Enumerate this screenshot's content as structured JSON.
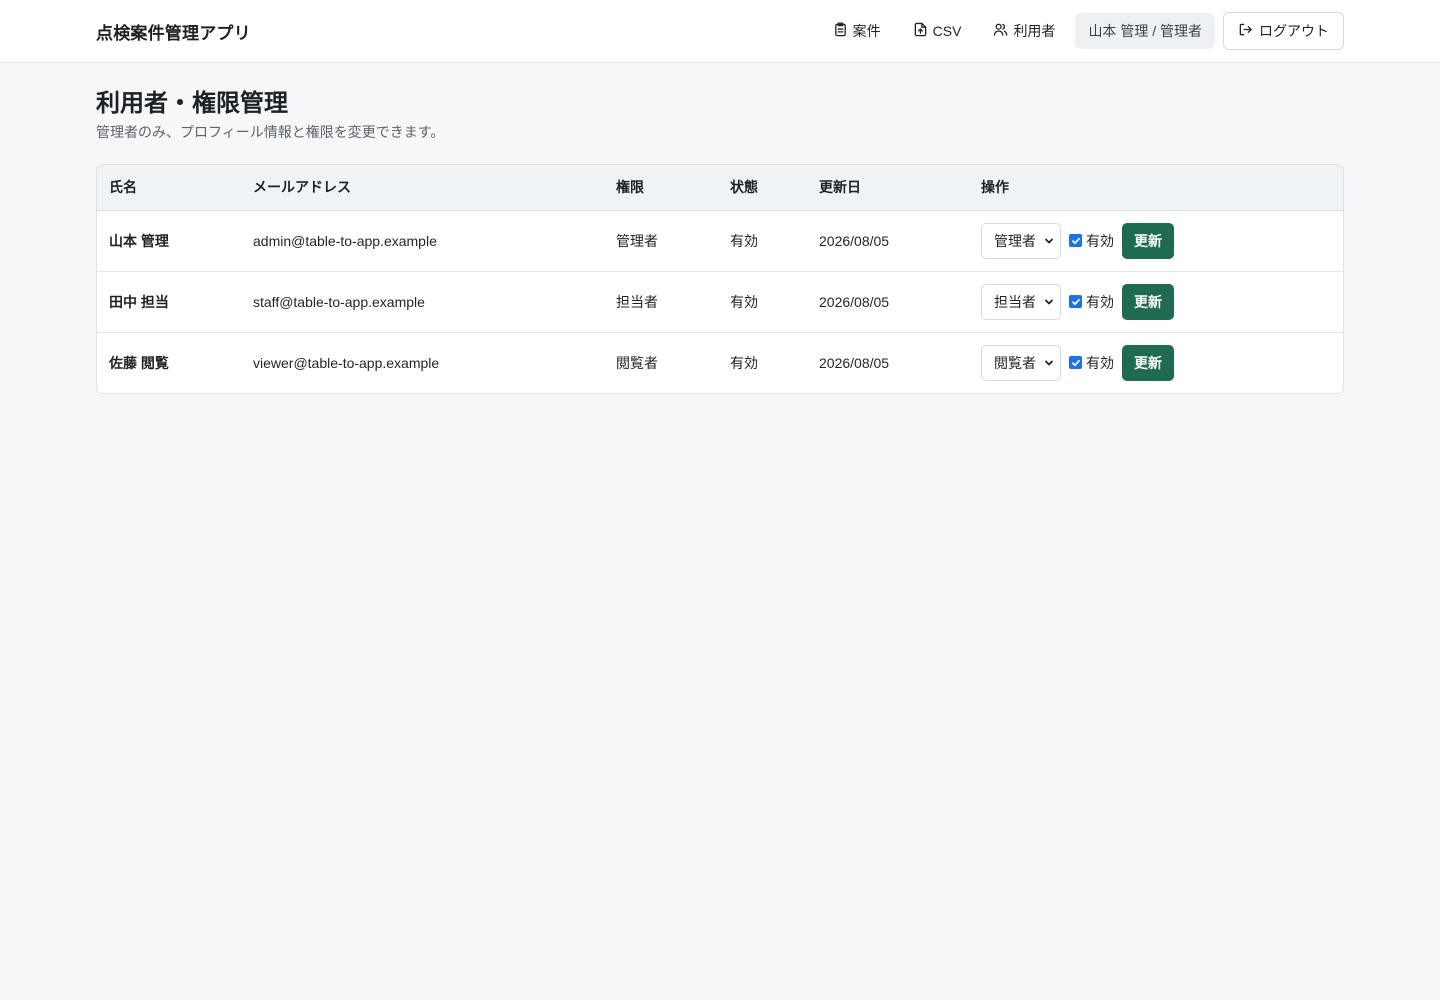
{
  "header": {
    "app_title": "点検案件管理アプリ",
    "nav": [
      {
        "label": "案件",
        "icon": "clipboard-icon"
      },
      {
        "label": "CSV",
        "icon": "file-upload-icon"
      },
      {
        "label": "利用者",
        "icon": "users-icon"
      }
    ],
    "user_label": "山本 管理 / 管理者",
    "logout_label": "ログアウト"
  },
  "page": {
    "title": "利用者・権限管理",
    "description": "管理者のみ、プロフィール情報と権限を変更できます。"
  },
  "table": {
    "columns": [
      "氏名",
      "メールアドレス",
      "権限",
      "状態",
      "更新日",
      "操作"
    ],
    "rows": [
      {
        "name": "山本 管理",
        "email": "admin@table-to-app.example",
        "role": "管理者",
        "status": "有効",
        "updated": "2026/08/05",
        "select_value": "管理者",
        "active_label": "有効",
        "active_checked": true,
        "update_label": "更新"
      },
      {
        "name": "田中 担当",
        "email": "staff@table-to-app.example",
        "role": "担当者",
        "status": "有効",
        "updated": "2026/08/05",
        "select_value": "担当者",
        "active_label": "有効",
        "active_checked": true,
        "update_label": "更新"
      },
      {
        "name": "佐藤 閲覧",
        "email": "viewer@table-to-app.example",
        "role": "閲覧者",
        "status": "有効",
        "updated": "2026/08/05",
        "select_value": "閲覧者",
        "active_label": "有効",
        "active_checked": true,
        "update_label": "更新"
      }
    ]
  },
  "colors": {
    "accent_button": "#1e6b50",
    "checkbox": "#1a73e8",
    "background": "#f6f7f9"
  }
}
